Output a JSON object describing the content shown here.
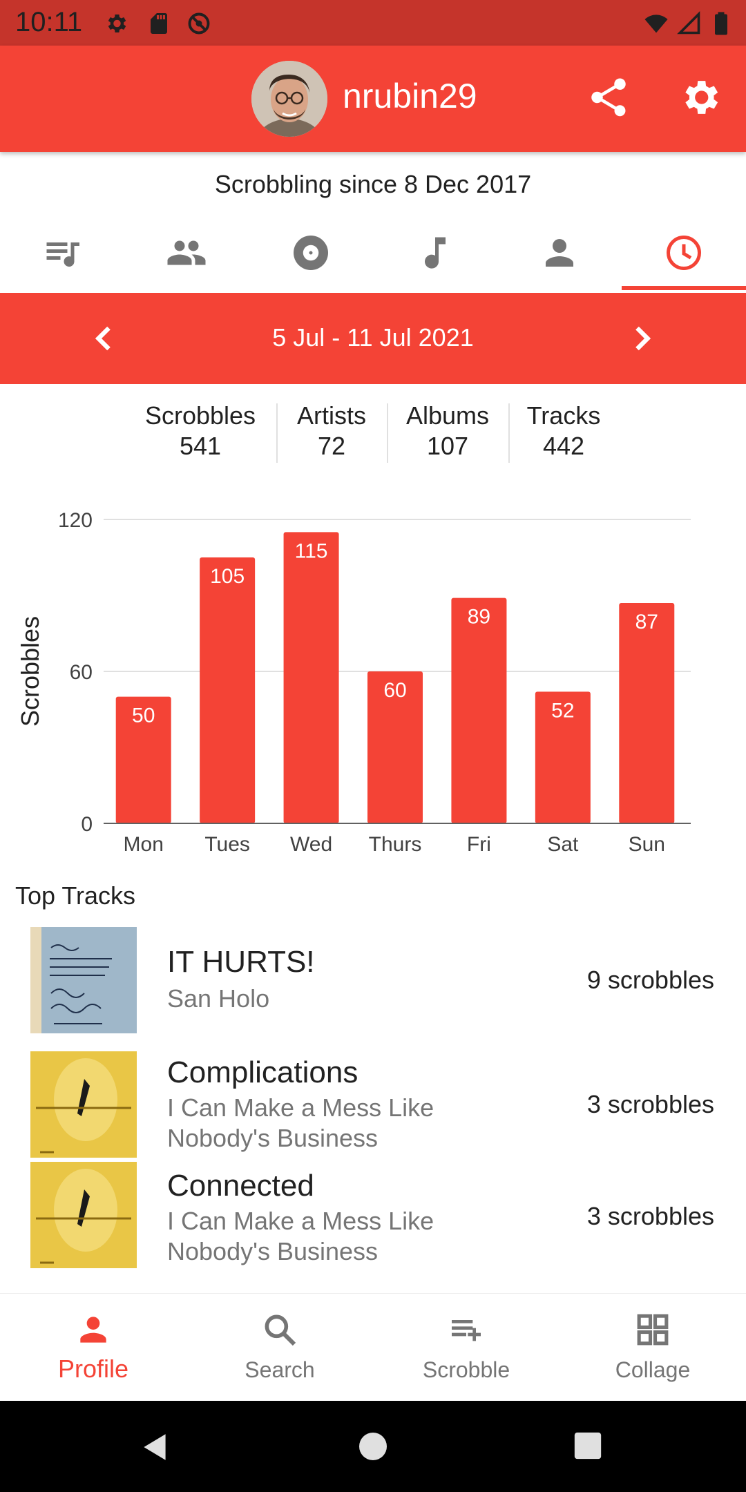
{
  "status_bar": {
    "time": "10:11",
    "icons": [
      "gear-icon",
      "sd-card-icon",
      "no-sync-icon",
      "wifi-icon",
      "signal-icon",
      "battery-icon"
    ]
  },
  "header": {
    "username": "nrubin29",
    "avatar": "profile-photo",
    "actions": [
      "share-icon",
      "settings-icon"
    ]
  },
  "profile": {
    "scrobbling_since": "Scrobbling since 8 Dec 2017"
  },
  "tabs": [
    {
      "icon": "playlist-icon",
      "active": false
    },
    {
      "icon": "people-icon",
      "active": false
    },
    {
      "icon": "album-icon",
      "active": false
    },
    {
      "icon": "music-note-icon",
      "active": false
    },
    {
      "icon": "person-icon",
      "active": false
    },
    {
      "icon": "clock-icon",
      "active": true
    }
  ],
  "period": {
    "label": "5 Jul - 11 Jul 2021"
  },
  "stats": [
    {
      "label": "Scrobbles",
      "value": "541"
    },
    {
      "label": "Artists",
      "value": "72"
    },
    {
      "label": "Albums",
      "value": "107"
    },
    {
      "label": "Tracks",
      "value": "442"
    }
  ],
  "chart_data": {
    "type": "bar",
    "categories": [
      "Mon",
      "Tues",
      "Wed",
      "Thurs",
      "Fri",
      "Sat",
      "Sun"
    ],
    "values": [
      50,
      105,
      115,
      60,
      89,
      52,
      87
    ],
    "ylabel": "Scrobbles",
    "xlabel": "",
    "ylim": [
      0,
      120
    ],
    "yticks": [
      0,
      60,
      120
    ],
    "data_labels": true,
    "grid": true,
    "color": "#f44336"
  },
  "top_tracks": {
    "title": "Top Tracks",
    "items": [
      {
        "title": "IT HURTS!",
        "artist": "San Holo",
        "count": "9 scrobbles"
      },
      {
        "title": "Complications",
        "artist": "I Can Make a Mess Like Nobody's Business",
        "count": "3 scrobbles"
      },
      {
        "title": "Connected",
        "artist": "I Can Make a Mess Like Nobody's Business",
        "count": "3 scrobbles"
      }
    ]
  },
  "bottom_nav": [
    {
      "label": "Profile",
      "icon": "person-icon",
      "active": true
    },
    {
      "label": "Search",
      "icon": "search-icon",
      "active": false
    },
    {
      "label": "Scrobble",
      "icon": "playlist-add-icon",
      "active": false
    },
    {
      "label": "Collage",
      "icon": "grid-icon",
      "active": false
    }
  ],
  "colors": {
    "primary": "#f44336",
    "status_bar": "#c5342b",
    "inactive_icon": "#757575"
  }
}
